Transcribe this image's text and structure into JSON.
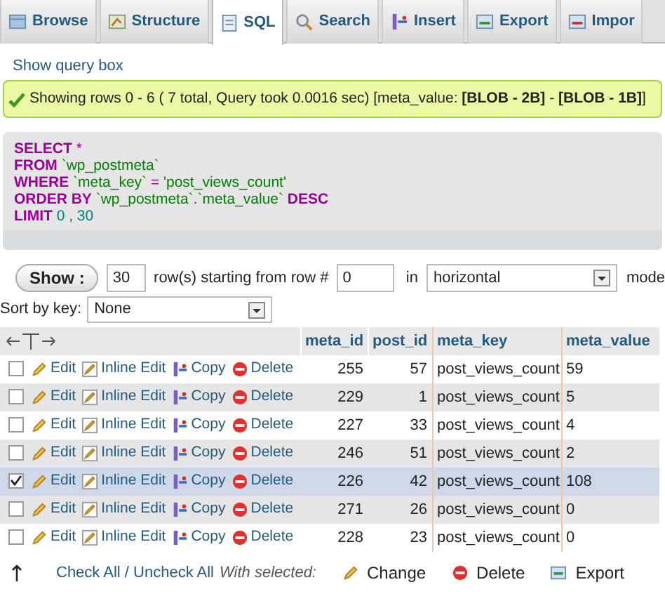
{
  "tabs": [
    {
      "label": "Browse",
      "selected": false
    },
    {
      "label": "Structure",
      "selected": false
    },
    {
      "label": "SQL",
      "selected": true
    },
    {
      "label": "Search",
      "selected": false
    },
    {
      "label": "Insert",
      "selected": false
    },
    {
      "label": "Export",
      "selected": false
    },
    {
      "label": "Impor",
      "selected": false
    }
  ],
  "show_query_box": "Show query box",
  "message": "Showing rows 0 - 6 ( 7 total, Query took 0.0016 sec) [meta_value: **[BLOB - 2B]** - **[BLOB - 1B]**]",
  "sql": [
    [
      {
        "kind": "keyword",
        "text": "SELECT"
      },
      {
        "kind": "plain",
        "text": " *"
      }
    ],
    [
      {
        "kind": "keyword",
        "text": "FROM"
      },
      {
        "kind": "string",
        "text": " `wp_postmeta`"
      }
    ],
    [
      {
        "kind": "keyword",
        "text": "WHERE"
      },
      {
        "kind": "string",
        "text": " `meta_key`"
      },
      {
        "kind": "plain",
        "text": " = "
      },
      {
        "kind": "string",
        "text": "'post_views_count'"
      }
    ],
    [
      {
        "kind": "keyword",
        "text": "ORDER BY"
      },
      {
        "kind": "string",
        "text": " `wp_postmeta`.`meta_value`"
      },
      {
        "kind": "keyword",
        "text": " DESC"
      }
    ],
    [
      {
        "kind": "keyword",
        "text": "LIMIT"
      },
      {
        "kind": "number",
        "text": " 0 , 30"
      }
    ]
  ],
  "navigation": {
    "show_button": "Show :",
    "rows": "30",
    "rows_label": "row(s) starting from row #",
    "start": "0",
    "in_label": "in",
    "mode": "horizontal",
    "mode_label": "mode"
  },
  "sort": {
    "label": "Sort by key:",
    "value": "None"
  },
  "table": {
    "columns": [
      "meta_id",
      "post_id",
      "meta_key",
      "meta_value"
    ],
    "rows": [
      {
        "checked": false,
        "actions": [
          "Edit",
          "Inline Edit",
          "Copy",
          "Delete"
        ],
        "cells": [
          "255",
          "57",
          "post_views_count",
          "59"
        ]
      },
      {
        "checked": false,
        "actions": [
          "Edit",
          "Inline Edit",
          "Copy",
          "Delete"
        ],
        "cells": [
          "229",
          "1",
          "post_views_count",
          "5"
        ]
      },
      {
        "checked": false,
        "actions": [
          "Edit",
          "Inline Edit",
          "Copy",
          "Delete"
        ],
        "cells": [
          "227",
          "33",
          "post_views_count",
          "4"
        ]
      },
      {
        "checked": false,
        "actions": [
          "Edit",
          "Inline Edit",
          "Copy",
          "Delete"
        ],
        "cells": [
          "246",
          "51",
          "post_views_count",
          "2"
        ]
      },
      {
        "checked": true,
        "actions": [
          "Edit",
          "Inline Edit",
          "Copy",
          "Delete"
        ],
        "cells": [
          "226",
          "42",
          "post_views_count",
          "108"
        ]
      },
      {
        "checked": false,
        "actions": [
          "Edit",
          "Inline Edit",
          "Copy",
          "Delete"
        ],
        "cells": [
          "271",
          "26",
          "post_views_count",
          "0"
        ]
      },
      {
        "checked": false,
        "actions": [
          "Edit",
          "Inline Edit",
          "Copy",
          "Delete"
        ],
        "cells": [
          "228",
          "23",
          "post_views_count",
          "0"
        ]
      }
    ]
  },
  "footer": {
    "check_all": "Check All / Uncheck All",
    "with_selected": "With selected:",
    "actions": [
      "Change",
      "Delete",
      "Export"
    ]
  }
}
